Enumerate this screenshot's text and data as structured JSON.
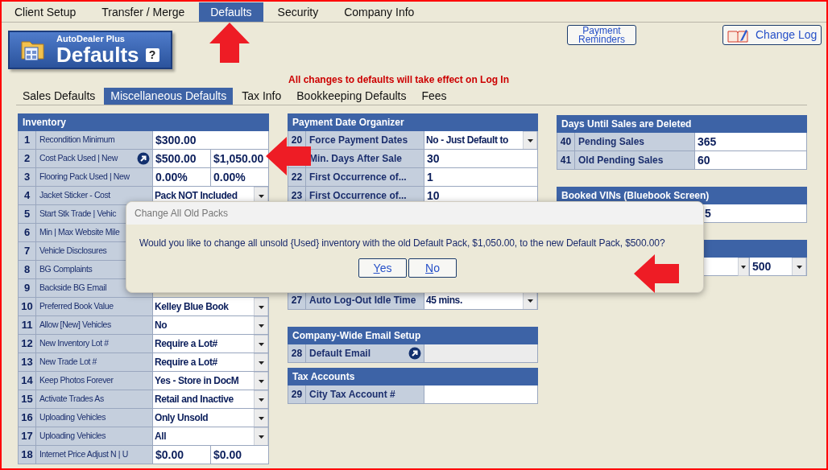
{
  "top_tabs": [
    {
      "label": "Client Setup",
      "selected": false
    },
    {
      "label": "Transfer / Merge",
      "selected": false
    },
    {
      "label": "Defaults",
      "selected": true
    },
    {
      "label": "Security",
      "selected": false
    },
    {
      "label": "Company Info",
      "selected": false
    }
  ],
  "logo": {
    "brand": "AutoDealer Plus",
    "title": "Defaults",
    "help": "?"
  },
  "header_buttons": [
    {
      "kind": "plain",
      "label": "Payment Reminders"
    },
    {
      "kind": "icon",
      "label": "Change Log"
    }
  ],
  "notice": "All changes to defaults will take effect on Log In",
  "sub_tabs": [
    {
      "label": "Sales Defaults",
      "selected": false
    },
    {
      "label": "Miscellaneous Defaults",
      "selected": true
    },
    {
      "label": "Tax Info",
      "selected": false
    },
    {
      "label": "Bookkeeping Defaults",
      "selected": false
    },
    {
      "label": "Fees",
      "selected": false
    }
  ],
  "columns": [
    [
      {
        "title": "Inventory",
        "rows": [
          {
            "number": "1",
            "label": "Recondition Minimum",
            "kind": "text",
            "values": [
              "$300.00"
            ]
          },
          {
            "number": "2",
            "label": "Cost Pack Used | New",
            "kind": "pair",
            "values": [
              "$500.00",
              "$1,050.00"
            ],
            "shortcut": true
          },
          {
            "number": "3",
            "label": "Flooring Pack Used | New",
            "kind": "pair",
            "values": [
              "0.00%",
              "0.00%"
            ]
          },
          {
            "number": "4",
            "label": "Jacket Sticker - Cost",
            "kind": "select",
            "values": [
              "Pack NOT Included"
            ]
          },
          {
            "number": "5",
            "label": "Start Stk Trade | Vehic",
            "kind": "covered"
          },
          {
            "number": "6",
            "label": "Min | Max Website Mile",
            "kind": "covered"
          },
          {
            "number": "7",
            "label": "Vehicle Disclosures",
            "kind": "covered"
          },
          {
            "number": "8",
            "label": "BG Complaints",
            "kind": "covered"
          },
          {
            "number": "9",
            "label": "Backside BG Email",
            "kind": "covered"
          },
          {
            "number": "10",
            "label": "Preferred Book Value",
            "kind": "select",
            "values": [
              "Kelley Blue Book"
            ]
          },
          {
            "number": "11",
            "label": "Allow [New] Vehicles",
            "kind": "select",
            "values": [
              "No"
            ]
          },
          {
            "number": "12",
            "label": "New Inventory Lot #",
            "kind": "select",
            "values": [
              "Require a Lot#"
            ]
          },
          {
            "number": "13",
            "label": "New Trade Lot #",
            "kind": "select",
            "values": [
              "Require a Lot#"
            ]
          },
          {
            "number": "14",
            "label": "Keep Photos Forever",
            "kind": "select",
            "values": [
              "Yes - Store in DocM"
            ]
          },
          {
            "number": "15",
            "label": "Activate Trades As",
            "kind": "select",
            "values": [
              "Retail and Inactive"
            ]
          },
          {
            "number": "16",
            "label": "Uploading Vehicles",
            "kind": "select",
            "values": [
              "Only Unsold"
            ]
          },
          {
            "number": "17",
            "label": "Uploading Vehicles",
            "kind": "select",
            "values": [
              "All"
            ]
          },
          {
            "number": "18",
            "label": "Internet Price Adjust N | U",
            "kind": "pair",
            "values": [
              "$0.00",
              "$0.00"
            ]
          }
        ]
      }
    ],
    [
      {
        "title": "Payment Date Organizer",
        "rows": [
          {
            "number": "20",
            "label": "Force Payment Dates",
            "kind": "select",
            "values": [
              "No - Just Default to"
            ]
          },
          {
            "label": "Min. Days After Sale",
            "kind": "text",
            "values": [
              "30"
            ]
          },
          {
            "number": "22",
            "label": "First Occurrence of...",
            "kind": "text",
            "values": [
              "1"
            ]
          },
          {
            "number": "23",
            "label": "First Occurrence of...",
            "kind": "text",
            "values": [
              "10"
            ]
          },
          {
            "kind": "hidden"
          },
          {
            "number": "27",
            "label": "Auto Log-Out Idle Time",
            "kind": "select",
            "values": [
              "45 mins."
            ]
          }
        ]
      },
      {
        "title": "Company-Wide Email Setup",
        "rows": [
          {
            "number": "28",
            "label": "Default Email",
            "kind": "empty",
            "shortcut": true
          }
        ]
      },
      {
        "title": "Tax Accounts",
        "rows": [
          {
            "number": "29",
            "label": "City Tax Account #",
            "kind": "text"
          }
        ]
      }
    ],
    [
      {
        "title": "Days Until Sales are Deleted",
        "rows": [
          {
            "number": "40",
            "label": "Pending Sales",
            "kind": "text",
            "values": [
              "365"
            ]
          },
          {
            "number": "41",
            "label": "Old Pending Sales",
            "kind": "text",
            "values": [
              "60"
            ]
          }
        ]
      },
      {
        "title": "Booked VINs (Bluebook Screen)",
        "rows": [
          {
            "kind": "partial",
            "values": [
              "5"
            ]
          }
        ]
      },
      {
        "rows": [
          {
            "kind": "select_pair",
            "values": [
              "500"
            ]
          }
        ]
      }
    ]
  ],
  "dialog": {
    "title": "Change All Old Packs",
    "message": "Would you like to change all unsold {Used} inventory with the old Default Pack, $1,050.00, to the new Default Pack, $500.00?",
    "buttons": [
      {
        "label": "Yes",
        "underline_first": true
      },
      {
        "label": "No",
        "underline_first": true
      }
    ]
  },
  "annotations": [
    {
      "kind": "up_arrow"
    },
    {
      "kind": "left_arrow"
    },
    {
      "kind": "left_arrow"
    }
  ]
}
